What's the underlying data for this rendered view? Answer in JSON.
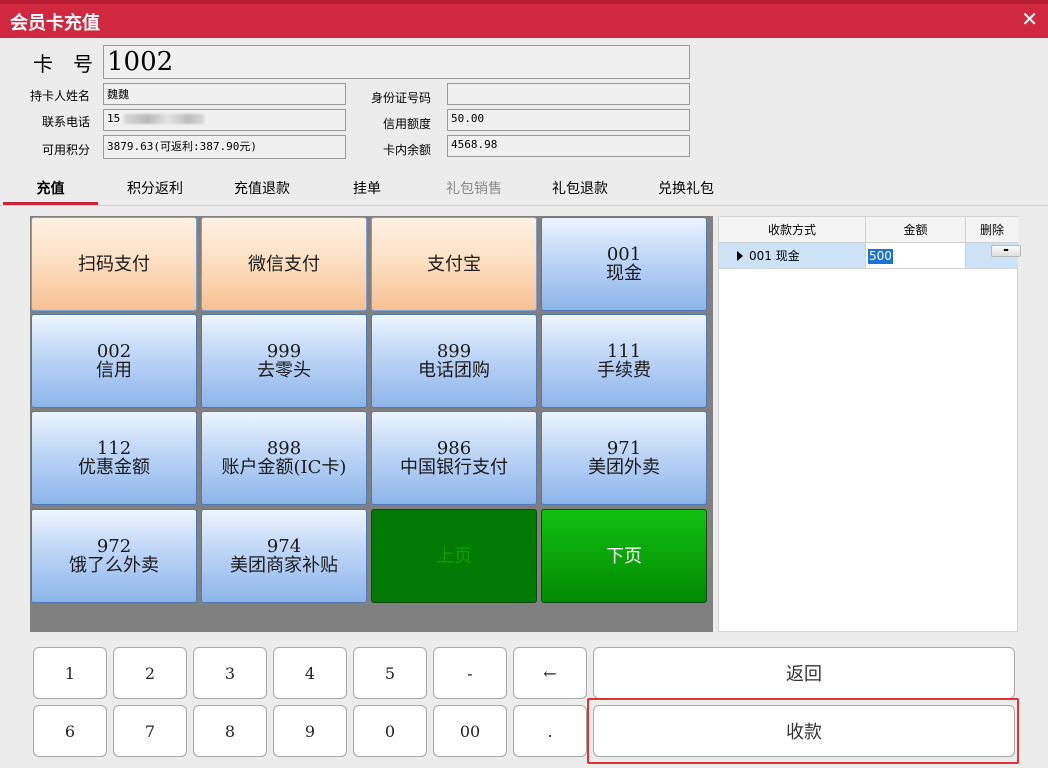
{
  "window": {
    "title": "会员卡充值",
    "close_glyph": "✕"
  },
  "card": {
    "card_no_label": "卡号",
    "card_no": "1002",
    "holder_label": "持卡人姓名",
    "holder": "魏魏",
    "phone_label": "联系电话",
    "phone": "15",
    "points_label": "可用积分",
    "points": "3879.63(可返利:387.90元)",
    "id_label": "身份证号码",
    "id_value": "",
    "credit_label": "信用额度",
    "credit": "50.00",
    "balance_label": "卡内余额",
    "balance": "4568.98"
  },
  "tabs": [
    {
      "label": "充值",
      "state": "active"
    },
    {
      "label": "积分返利",
      "state": "normal"
    },
    {
      "label": "充值退款",
      "state": "normal"
    },
    {
      "label": "挂单",
      "state": "normal"
    },
    {
      "label": "礼包销售",
      "state": "disabled"
    },
    {
      "label": "礼包退款",
      "state": "normal"
    },
    {
      "label": "兑换礼包",
      "state": "normal"
    }
  ],
  "payment_methods": [
    {
      "code": "",
      "name": "扫码支付",
      "style": "orange"
    },
    {
      "code": "",
      "name": "微信支付",
      "style": "orange"
    },
    {
      "code": "",
      "name": "支付宝",
      "style": "orange"
    },
    {
      "code": "001",
      "name": "现金",
      "style": "blue"
    },
    {
      "code": "002",
      "name": "信用",
      "style": "blue"
    },
    {
      "code": "999",
      "name": "去零头",
      "style": "blue"
    },
    {
      "code": "899",
      "name": "电话团购",
      "style": "blue"
    },
    {
      "code": "111",
      "name": "手续费",
      "style": "blue"
    },
    {
      "code": "112",
      "name": "优惠金额",
      "style": "blue"
    },
    {
      "code": "898",
      "name": "账户金额(IC卡)",
      "style": "blue"
    },
    {
      "code": "986",
      "name": "中国银行支付",
      "style": "blue"
    },
    {
      "code": "971",
      "name": "美团外卖",
      "style": "blue"
    },
    {
      "code": "972",
      "name": "饿了么外卖",
      "style": "blue"
    },
    {
      "code": "974",
      "name": "美团商家补贴",
      "style": "blue"
    },
    {
      "code": "",
      "name": "上页",
      "style": "dkgreen"
    },
    {
      "code": "",
      "name": "下页",
      "style": "green"
    }
  ],
  "payments_table": {
    "headers": [
      "收款方式",
      "金额",
      "删除"
    ],
    "rows": [
      {
        "method": "001 现金",
        "amount": "500",
        "delete": "-"
      }
    ]
  },
  "keypad": {
    "keys": [
      "1",
      "2",
      "3",
      "4",
      "5",
      "-",
      "←",
      "6",
      "7",
      "8",
      "9",
      "0",
      "00",
      "."
    ],
    "back_label": "返回",
    "collect_label": "收款"
  },
  "colors": {
    "titlebar": "#d0293f",
    "active_tab_underline": "#c7253a",
    "highlight": "#e0303a"
  }
}
